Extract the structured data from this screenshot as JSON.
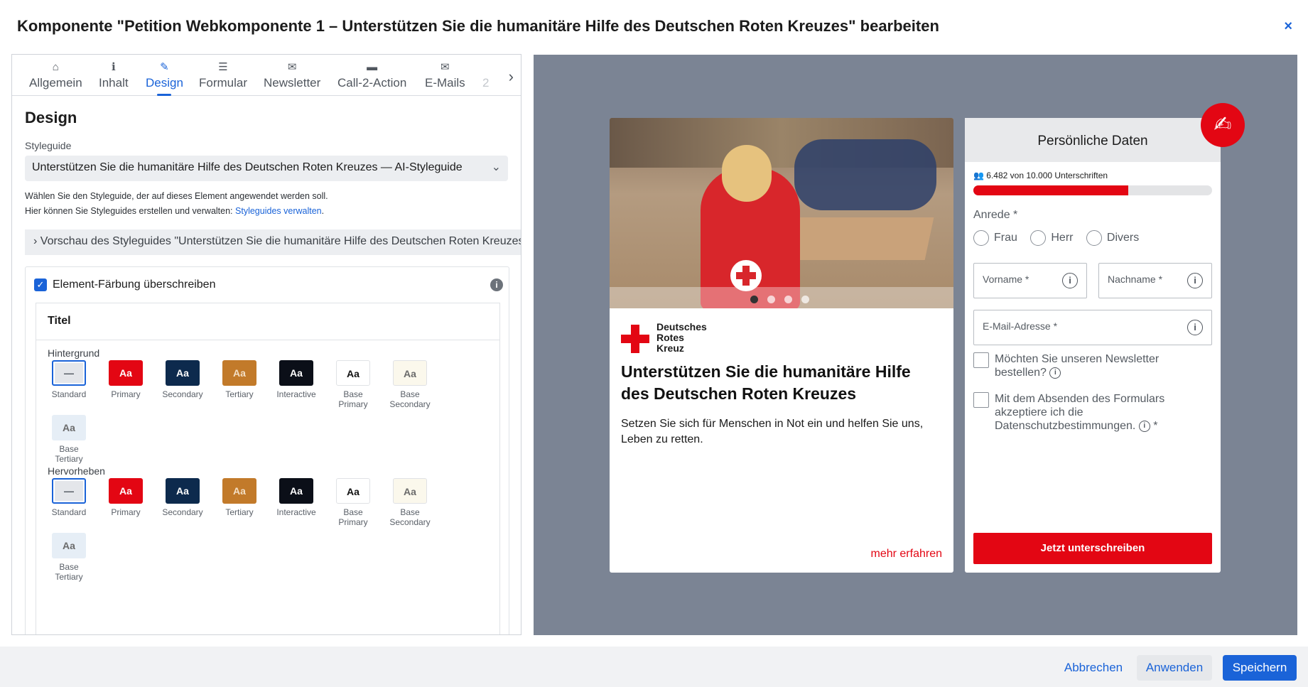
{
  "dialog": {
    "title": "Komponente \"Petition Webkomponente 1 – Unterstützen Sie die humanitäre Hilfe des Deutschen Roten Kreuzes\" bearbeiten",
    "close": "×"
  },
  "tabs": [
    {
      "label": "Allgemein",
      "icon": "home-icon",
      "glyph": "⌂"
    },
    {
      "label": "Inhalt",
      "icon": "info-icon",
      "glyph": "ℹ"
    },
    {
      "label": "Design",
      "icon": "brush-icon",
      "glyph": "✎"
    },
    {
      "label": "Formular",
      "icon": "list-icon",
      "glyph": "☰"
    },
    {
      "label": "Newsletter",
      "icon": "envelope-open-icon",
      "glyph": "✉"
    },
    {
      "label": "Call-2-Action",
      "icon": "button-icon",
      "glyph": "▬"
    },
    {
      "label": "E-Mails",
      "icon": "envelope-icon",
      "glyph": "✉"
    },
    {
      "label": "2",
      "icon": "",
      "glyph": ""
    }
  ],
  "tab_next": "›",
  "design": {
    "title": "Design",
    "styleguide_label": "Styleguide",
    "styleguide_value": "Unterstützen Sie die humanitäre Hilfe des Deutschen Roten Kreuzes — AI-Styleguide",
    "help_line1": "Wählen Sie den Styleguide, der auf dieses Element angewendet werden soll.",
    "help_line2_prefix": "Hier können Sie Styleguides erstellen und verwalten: ",
    "help_link": "Styleguides verwalten",
    "help_line2_suffix": ".",
    "preview_toggle": "›  Vorschau des Styleguides \"Unterstützen Sie die humanitäre Hilfe des Deutschen Roten Kreuzes — AI-Styleguide\"",
    "override_label": "Element-Färbung überschreiben",
    "titel": "Titel",
    "hintergrund": "Hintergrund",
    "hervorheben": "Hervorheben",
    "swatch_text": "Aa",
    "swatches": [
      {
        "label": "Standard",
        "bg": "#e4e6ea",
        "fg": "#50565e",
        "text": "—"
      },
      {
        "label": "Primary",
        "bg": "#e30613",
        "fg": "#ffffff",
        "text": "Aa"
      },
      {
        "label": "Secondary",
        "bg": "#0d2a4d",
        "fg": "#ffffff",
        "text": "Aa"
      },
      {
        "label": "Tertiary",
        "bg": "#c27a2a",
        "fg": "#f3dfc5",
        "text": "Aa"
      },
      {
        "label": "Interactive",
        "bg": "#0b0f18",
        "fg": "#ffffff",
        "text": "Aa"
      },
      {
        "label": "Base Primary",
        "bg": "#ffffff",
        "fg": "#111111",
        "text": "Aa"
      },
      {
        "label": "Base Secondary",
        "bg": "#fbf8ec",
        "fg": "#6b6b6b",
        "text": "Aa"
      },
      {
        "label": "Base Tertiary",
        "bg": "#e6eef6",
        "fg": "#6b6b6b",
        "text": "Aa"
      }
    ]
  },
  "preview": {
    "org_lines": [
      "Deutsches",
      "Rotes",
      "Kreuz"
    ],
    "card_title": "Unterstützen Sie die humanitäre Hilfe des Deutschen Roten Kreuzes",
    "card_text": "Setzen Sie sich für Menschen in Not ein und helfen Sie uns, Leben zu retten.",
    "more_link": "mehr erfahren",
    "slide_count": 4,
    "form_title": "Persönliche Daten",
    "signature_count": "6.482 von 10.000 Unterschriften",
    "progress_fraction": 0.6482,
    "anrede": "Anrede *",
    "radio_options": [
      "Frau",
      "Herr",
      "Divers"
    ],
    "vorname": "Vorname *",
    "nachname": "Nachname *",
    "email": "E-Mail-Adresse *",
    "newsletter": "Möchten Sie unseren Newsletter bestellen?",
    "privacy": "Mit dem Absenden des Formulars akzeptiere ich die Datenschutzbestimmungen.",
    "required_mark": "*",
    "submit": "Jetzt unterschreiben"
  },
  "footer": {
    "cancel": "Abbrechen",
    "apply": "Anwenden",
    "save": "Speichern"
  },
  "colors": {
    "accent": "#1a63d8",
    "drk_red": "#e30613",
    "preview_bg": "#7b8494"
  }
}
